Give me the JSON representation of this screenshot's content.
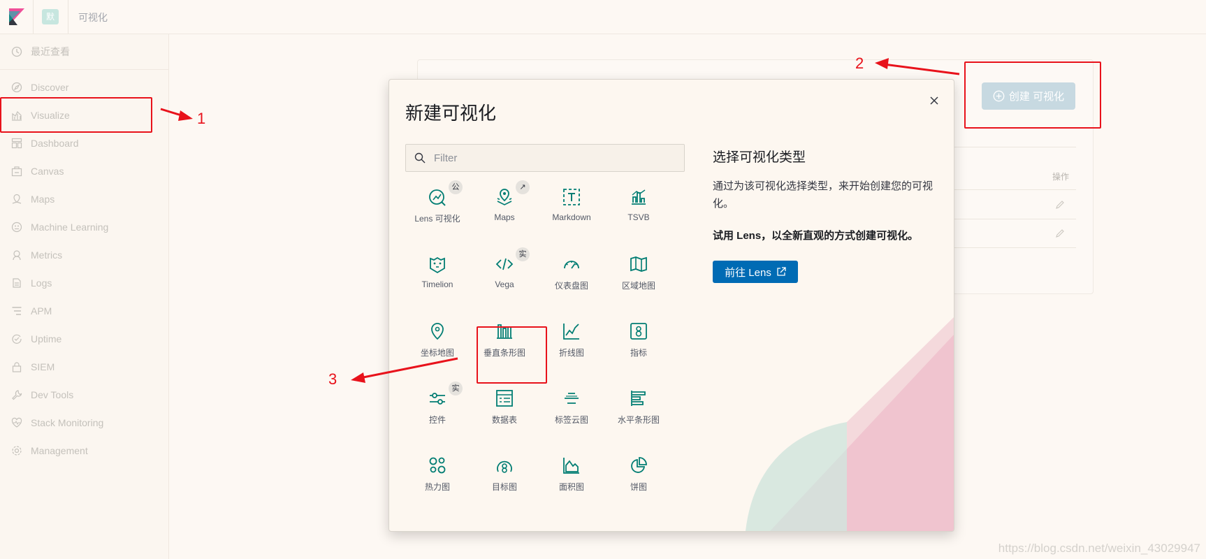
{
  "header": {
    "space_initial": "默",
    "breadcrumb": "可视化"
  },
  "sidebar": {
    "items": [
      {
        "label": "最近查看",
        "icon": "clock-icon"
      },
      {
        "label": "Discover",
        "icon": "compass-icon"
      },
      {
        "label": "Visualize",
        "icon": "visualize-icon"
      },
      {
        "label": "Dashboard",
        "icon": "dashboard-icon"
      },
      {
        "label": "Canvas",
        "icon": "canvas-icon"
      },
      {
        "label": "Maps",
        "icon": "maps-icon"
      },
      {
        "label": "Machine Learning",
        "icon": "machine-learning-icon"
      },
      {
        "label": "Metrics",
        "icon": "metrics-icon"
      },
      {
        "label": "Logs",
        "icon": "logs-icon"
      },
      {
        "label": "APM",
        "icon": "apm-icon"
      },
      {
        "label": "Uptime",
        "icon": "uptime-icon"
      },
      {
        "label": "SIEM",
        "icon": "siem-icon"
      },
      {
        "label": "Dev Tools",
        "icon": "dev-tools-icon"
      },
      {
        "label": "Stack Monitoring",
        "icon": "heartbeat-icon"
      },
      {
        "label": "Management",
        "icon": "gear-icon"
      }
    ]
  },
  "background_page": {
    "create_button_label": "创建 可视化",
    "actions_header": "操作"
  },
  "modal": {
    "title": "新建可视化",
    "filter_placeholder": "Filter",
    "tiles": [
      {
        "label": "Lens 可视化",
        "icon": "lens-icon",
        "badge": "公"
      },
      {
        "label": "Maps",
        "icon": "map-pin-layers-icon",
        "badge": "↗"
      },
      {
        "label": "Markdown",
        "icon": "markdown-icon",
        "badge": ""
      },
      {
        "label": "TSVB",
        "icon": "tsvb-icon",
        "badge": ""
      },
      {
        "label": "Timelion",
        "icon": "timelion-icon",
        "badge": ""
      },
      {
        "label": "Vega",
        "icon": "code-icon",
        "badge": "实"
      },
      {
        "label": "仪表盘图",
        "icon": "gauge-icon",
        "badge": ""
      },
      {
        "label": "区域地图",
        "icon": "region-map-icon",
        "badge": ""
      },
      {
        "label": "坐标地图",
        "icon": "coordinate-map-icon",
        "badge": ""
      },
      {
        "label": "垂直条形图",
        "icon": "vertical-bar-icon",
        "badge": ""
      },
      {
        "label": "折线图",
        "icon": "line-chart-icon",
        "badge": ""
      },
      {
        "label": "指标",
        "icon": "metric-icon",
        "badge": ""
      },
      {
        "label": "控件",
        "icon": "controls-icon",
        "badge": "实"
      },
      {
        "label": "数据表",
        "icon": "data-table-icon",
        "badge": ""
      },
      {
        "label": "标签云图",
        "icon": "tag-cloud-icon",
        "badge": ""
      },
      {
        "label": "水平条形图",
        "icon": "horizontal-bar-icon",
        "badge": ""
      },
      {
        "label": "热力图",
        "icon": "heatmap-icon",
        "badge": ""
      },
      {
        "label": "目标图",
        "icon": "goal-icon",
        "badge": ""
      },
      {
        "label": "面积图",
        "icon": "area-chart-icon",
        "badge": ""
      },
      {
        "label": "饼图",
        "icon": "pie-chart-icon",
        "badge": ""
      }
    ],
    "right_title": "选择可视化类型",
    "right_description": "通过为该可视化选择类型，来开始创建您的可视化。",
    "right_bold": "试用 Lens，以全新直观的方式创建可视化。",
    "lens_button_label": "前往 Lens"
  },
  "annotations": {
    "step1": "1",
    "step2": "2",
    "step3": "3",
    "color": "#e8121b"
  },
  "watermark": "https://blog.csdn.net/weixin_43029947",
  "colors": {
    "accent": "#006bb4",
    "icon_teal": "#017d73",
    "background": "#fdf8f3"
  }
}
